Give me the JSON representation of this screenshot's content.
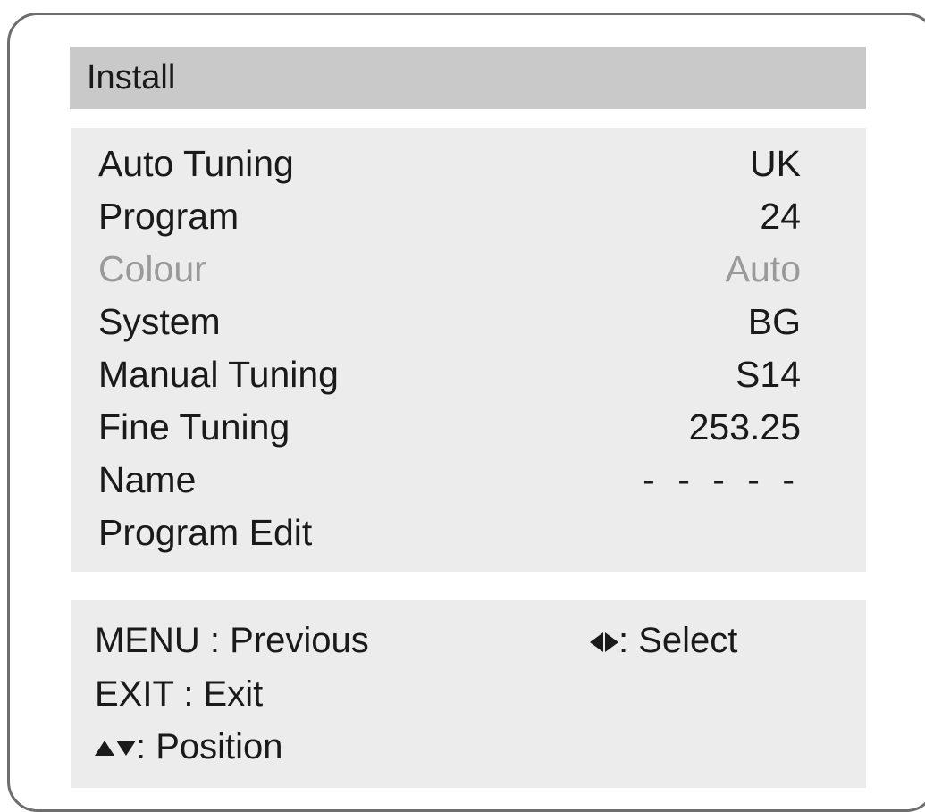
{
  "header": {
    "title": "Install"
  },
  "menu": {
    "items": [
      {
        "label": "Auto Tuning",
        "value": "UK",
        "enabled": true
      },
      {
        "label": "Program",
        "value": "24",
        "enabled": true
      },
      {
        "label": "Colour",
        "value": "Auto",
        "enabled": false
      },
      {
        "label": "System",
        "value": "BG",
        "enabled": true
      },
      {
        "label": "Manual Tuning",
        "value": "S14",
        "enabled": true
      },
      {
        "label": "Fine Tuning",
        "value": "253.25",
        "enabled": true
      },
      {
        "label": "Name",
        "value": "- - - - -",
        "enabled": true
      },
      {
        "label": "Program Edit",
        "value": "",
        "enabled": true
      }
    ]
  },
  "help": {
    "menu_key": "MENU",
    "menu_action": ": Previous",
    "exit_key": "EXIT",
    "exit_action": ": Exit",
    "position_icon": "up-down-arrows-icon",
    "position_action": ": Position",
    "select_icon": "left-right-arrows-icon",
    "select_action": ": Select"
  },
  "colors": {
    "title_bar": "#c9c9c9",
    "panel": "#ececec",
    "frame_border": "#6e6e6e",
    "text": "#1a1a1a",
    "disabled_text": "#9a9a9a"
  }
}
